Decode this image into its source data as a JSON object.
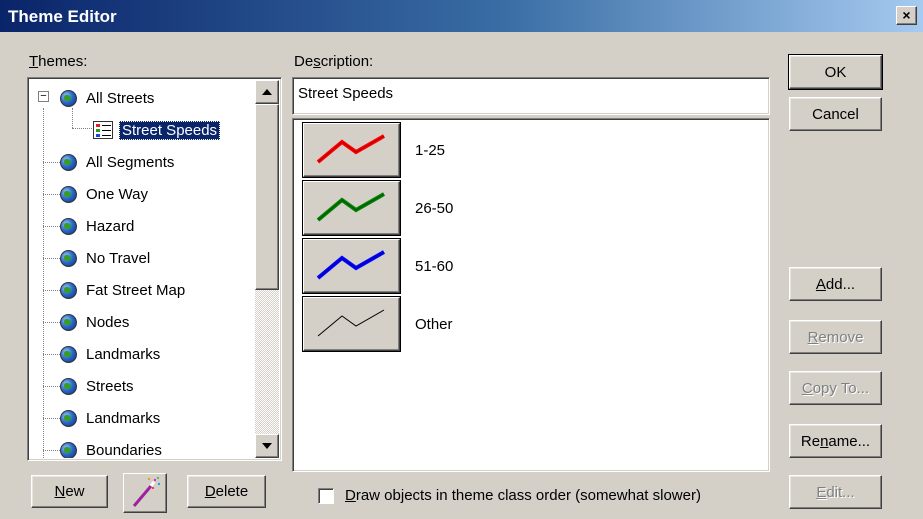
{
  "window": {
    "title": "Theme Editor",
    "close_glyph": "×"
  },
  "themes_label": "Themes:",
  "themes_label_key": "T",
  "themes_label_rest": "hemes:",
  "tree": {
    "expanded_toggle": "−",
    "items": [
      {
        "label": "All Streets",
        "icon": "globe-icon",
        "expanded": true
      },
      {
        "label": "Street Speeds",
        "icon": "theme-legend-icon",
        "selected": true,
        "child": true
      },
      {
        "label": "All Segments",
        "icon": "globe-icon"
      },
      {
        "label": "One Way",
        "icon": "globe-icon"
      },
      {
        "label": "Hazard",
        "icon": "globe-icon"
      },
      {
        "label": "No Travel",
        "icon": "globe-icon"
      },
      {
        "label": "Fat Street Map",
        "icon": "globe-icon"
      },
      {
        "label": "Nodes",
        "icon": "globe-icon"
      },
      {
        "label": "Landmarks",
        "icon": "globe-icon"
      },
      {
        "label": "Streets",
        "icon": "globe-icon"
      },
      {
        "label": "Landmarks",
        "icon": "globe-icon"
      },
      {
        "label": "Boundaries",
        "icon": "globe-icon"
      }
    ]
  },
  "description": {
    "label_a": "De",
    "label_key": "s",
    "label_b": "cription:",
    "value": "Street Speeds"
  },
  "legend": [
    {
      "label": "1-25",
      "color": "#ff0000"
    },
    {
      "label": "26-50",
      "color": "#008000"
    },
    {
      "label": "51-60",
      "color": "#0000ff"
    },
    {
      "label": "Other",
      "color": "#000000"
    }
  ],
  "buttons": {
    "ok": "OK",
    "cancel": "Cancel",
    "add_key": "A",
    "add_rest": "dd...",
    "remove_key": "R",
    "remove_rest": "emove",
    "copy_key": "C",
    "copy_rest": "opy To...",
    "rename_a": "Re",
    "rename_key": "n",
    "rename_b": "ame...",
    "edit_key": "E",
    "edit_rest": "dit...",
    "new_key": "N",
    "new_rest": "ew",
    "delete_key": "D",
    "delete_rest": "elete"
  },
  "checkbox": {
    "key": "D",
    "rest": "raw objects in theme class order (somewhat slower)",
    "checked": false
  }
}
